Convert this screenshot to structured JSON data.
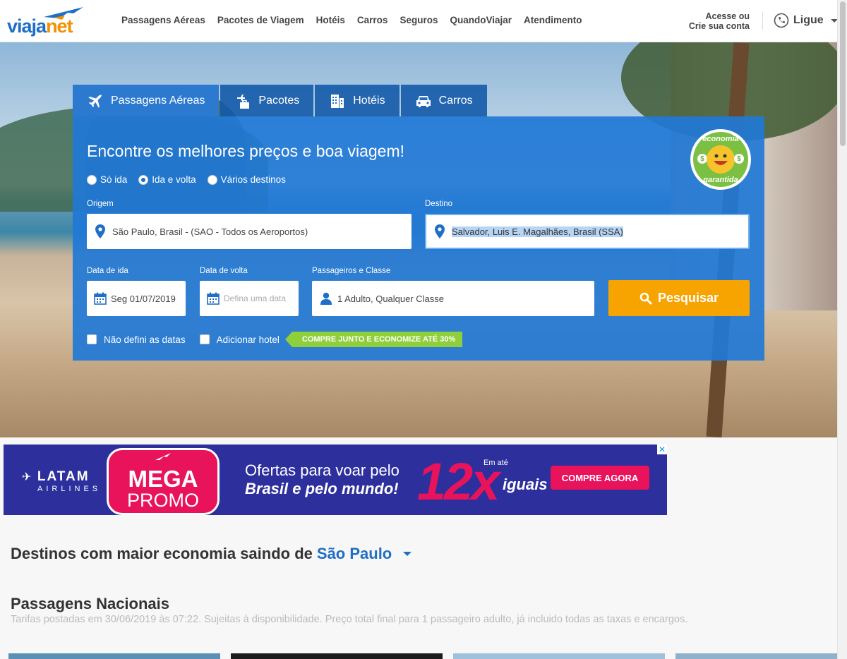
{
  "header": {
    "logo": {
      "main": "viaja",
      "accent": "net"
    },
    "nav": [
      "Passagens Aéreas",
      "Pacotes de Viagem",
      "Hotéis",
      "Carros",
      "Seguros",
      "QuandoViajar",
      "Atendimento"
    ],
    "account_line1": "Acesse ou",
    "account_line2": "Crie sua conta",
    "ligue": "Ligue"
  },
  "search": {
    "tabs": [
      {
        "label": "Passagens Aéreas",
        "icon": "plane-icon",
        "active": true
      },
      {
        "label": "Pacotes",
        "icon": "package-icon",
        "active": false
      },
      {
        "label": "Hotéis",
        "icon": "hotel-icon",
        "active": false
      },
      {
        "label": "Carros",
        "icon": "car-icon",
        "active": false
      }
    ],
    "title": "Encontre os melhores preços e boa viagem!",
    "trip_types": [
      "Só ida",
      "Ida e volta",
      "Vários destinos"
    ],
    "selected_trip_type": "Ida e volta",
    "origin_label": "Origem",
    "origin_value": "São Paulo, Brasil - (SAO - Todos os Aeroportos)",
    "destination_label": "Destino",
    "destination_value": "Salvador, Luis E. Magalhães, Brasil (SSA)",
    "depart_label": "Data de ida",
    "depart_value": "Seg 01/07/2019",
    "return_label": "Data de volta",
    "return_placeholder": "Defina uma data",
    "passengers_label": "Passageiros e Classe",
    "passengers_value": "1 Adulto, Qualquer Classe",
    "search_button": "Pesquisar",
    "no_dates_label": "Não defini as datas",
    "add_hotel_label": "Adicionar hotel",
    "promo_tag": "COMPRE JUNTO E ECONOMIZE ATÉ 30%",
    "badge_top": "economia",
    "badge_bottom": "garantida"
  },
  "ad": {
    "airline": "LATAM",
    "airline_sub": "AIRLINES",
    "mega": "MEGA",
    "promo": "PROMO",
    "line1": "Ofertas para voar pelo",
    "line2": "Brasil e pelo mundo!",
    "installments": "12x",
    "em_ate": "Em até",
    "iguais": "iguais",
    "cta": "COMPRE AGORA",
    "close": "✕"
  },
  "content": {
    "economy_title": "Destinos com maior economia saindo de",
    "economy_city": "São Paulo",
    "national_title": "Passagens Nacionais",
    "national_subtitle": "Tarifas postadas em 30/06/2019 às 07:22. Sujeitas à disponibilidade. Preço total final para 1 passageiro adulto, já incluido todas as taxas e encargos."
  },
  "colors": {
    "brand_blue": "#1f6ec7",
    "brand_orange": "#f29100",
    "search_button": "#f7a400",
    "promo_green": "#8fcf3c",
    "ad_pink": "#e8135a"
  }
}
